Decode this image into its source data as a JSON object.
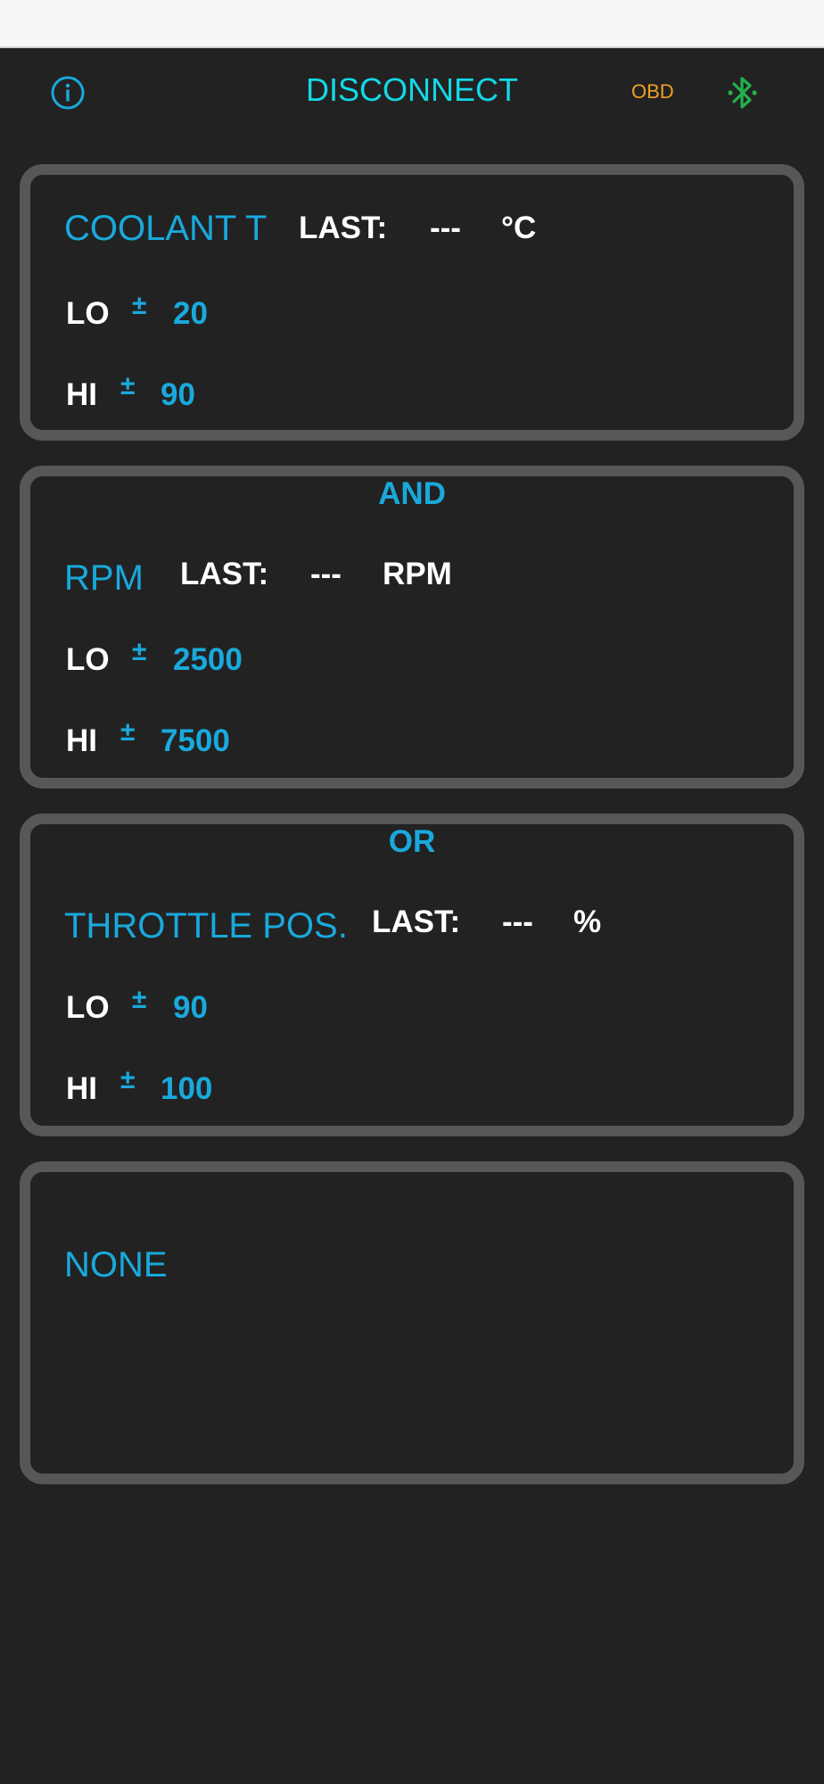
{
  "topbar": {
    "disconnect_label": "DISCONNECT",
    "obd_label": "OBD",
    "info_icon": "info-circle-icon",
    "bluetooth_icon": "bluetooth-icon"
  },
  "colors": {
    "background": "#222222",
    "card_border": "#575757",
    "accent_blue": "#19a9dc",
    "disconnect_cyan": "#14d8e6",
    "obd_orange": "#f0a020",
    "bluetooth_green": "#22b14c"
  },
  "conditions": [
    {
      "logic": "",
      "sensor": "COOLANT T",
      "last_label": "LAST:",
      "last_value": "---",
      "unit": "°C",
      "lo_label": "LO",
      "lo_symbol": "±",
      "lo_value": "20",
      "hi_label": "HI",
      "hi_symbol": "±",
      "hi_value": "90"
    },
    {
      "logic": "AND",
      "sensor": "RPM",
      "last_label": "LAST:",
      "last_value": "---",
      "unit": "RPM",
      "lo_label": "LO",
      "lo_symbol": "±",
      "lo_value": "2500",
      "hi_label": "HI",
      "hi_symbol": "±",
      "hi_value": "7500"
    },
    {
      "logic": "OR",
      "sensor": "THROTTLE POS.",
      "last_label": "LAST:",
      "last_value": "---",
      "unit": "%",
      "lo_label": "LO",
      "lo_symbol": "±",
      "lo_value": "90",
      "hi_label": "HI",
      "hi_symbol": "±",
      "hi_value": "100"
    },
    {
      "logic": "",
      "sensor": "NONE"
    }
  ]
}
